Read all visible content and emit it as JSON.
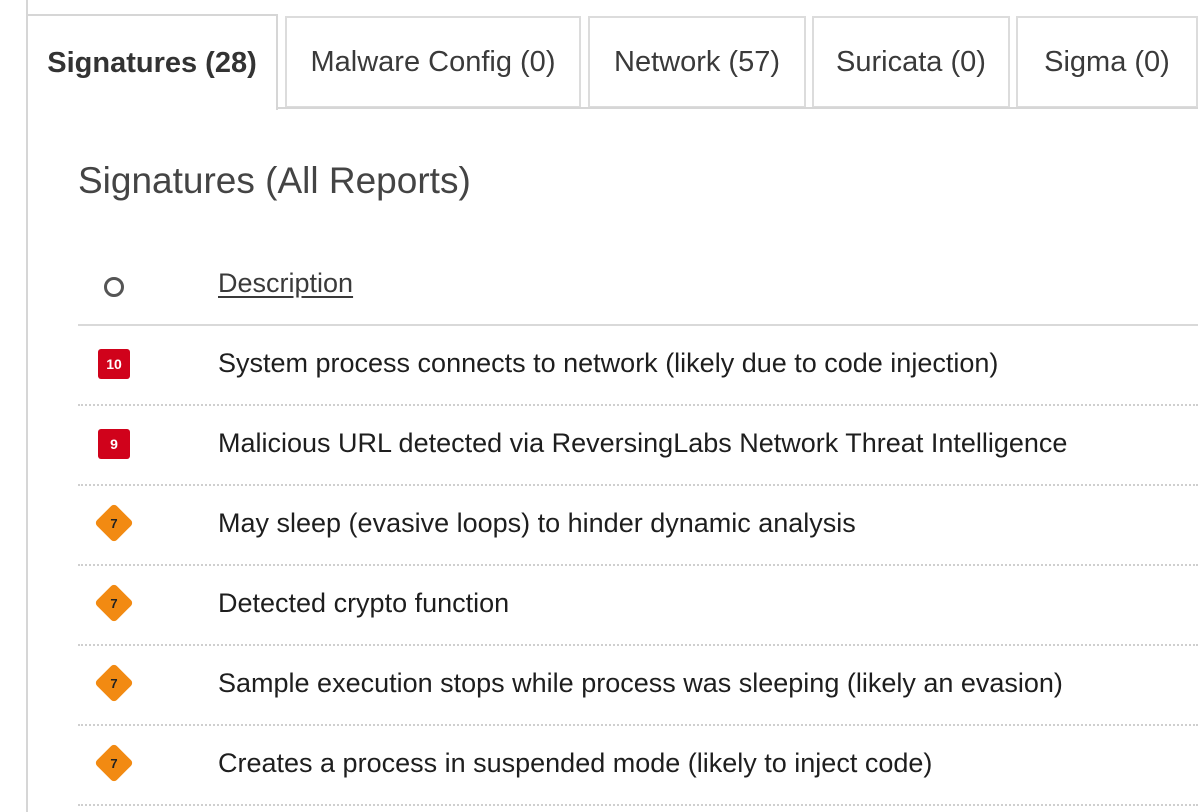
{
  "tabs": [
    {
      "label": "Signatures (28)",
      "active": true
    },
    {
      "label": "Malware Config (0)",
      "active": false
    },
    {
      "label": "Network (57)",
      "active": false
    },
    {
      "label": "Suricata (0)",
      "active": false
    },
    {
      "label": "Sigma (0)",
      "active": false
    }
  ],
  "section_title": "Signatures (All Reports)",
  "table": {
    "sort_icon": "circle-icon",
    "description_header": "Description",
    "rows": [
      {
        "score": "10",
        "severity": "critical",
        "badge_shape": "square",
        "badge_color": "#d0021b",
        "description": "System process connects to network (likely due to code injection)"
      },
      {
        "score": "9",
        "severity": "critical",
        "badge_shape": "square",
        "badge_color": "#d0021b",
        "description": "Malicious URL detected via ReversingLabs Network Threat Intelligence"
      },
      {
        "score": "7",
        "severity": "high",
        "badge_shape": "diamond",
        "badge_color": "#f28a12",
        "description": "May sleep (evasive loops) to hinder dynamic analysis"
      },
      {
        "score": "7",
        "severity": "high",
        "badge_shape": "diamond",
        "badge_color": "#f28a12",
        "description": "Detected crypto function"
      },
      {
        "score": "7",
        "severity": "high",
        "badge_shape": "diamond",
        "badge_color": "#f28a12",
        "description": "Sample execution stops while process was sleeping (likely an evasion)"
      },
      {
        "score": "7",
        "severity": "high",
        "badge_shape": "diamond",
        "badge_color": "#f28a12",
        "description": "Creates a process in suspended mode (likely to inject code)"
      }
    ]
  }
}
